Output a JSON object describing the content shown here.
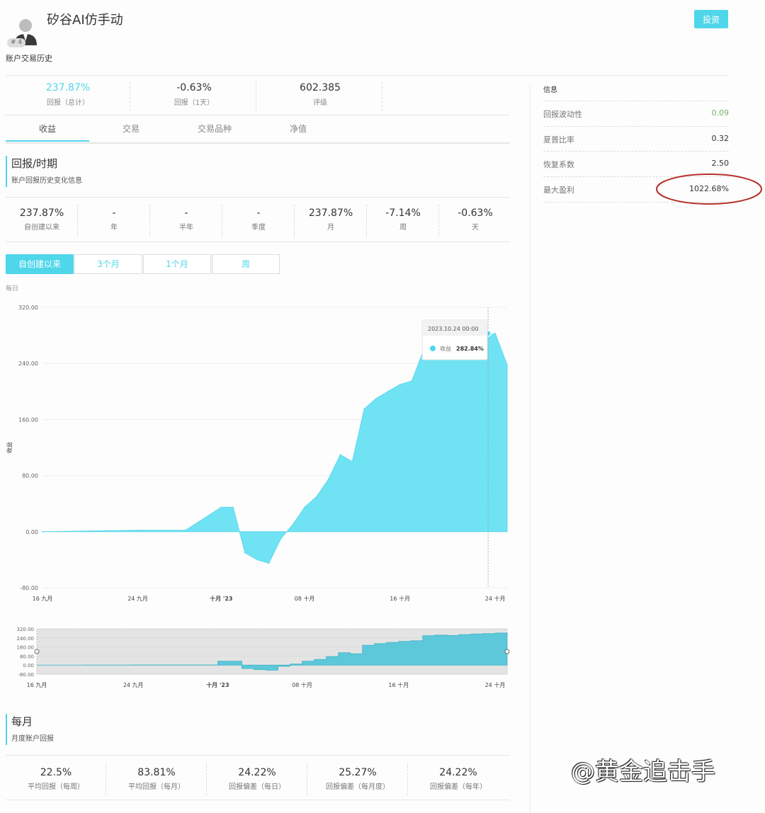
{
  "header": {
    "title": "矽谷AI仿手动",
    "badge": "# 4",
    "subtitle": "账户交易历史",
    "invest_label": "投资"
  },
  "stats": [
    {
      "value": "237.87%",
      "label": "回报（总计）",
      "color": "#4fd6ea"
    },
    {
      "value": "-0.63%",
      "label": "回报（1天）",
      "color": "#333333"
    },
    {
      "value": "602.385",
      "label": "评级",
      "color": "#333333"
    }
  ],
  "tabs": [
    "收益",
    "交易",
    "交易品种",
    "净值"
  ],
  "section_return": {
    "title": "回报/时期",
    "subtitle": "账户回报历史变化信息"
  },
  "periods": [
    {
      "value": "237.87%",
      "label": "自创建以来"
    },
    {
      "value": "-",
      "label": "年"
    },
    {
      "value": "-",
      "label": "半年"
    },
    {
      "value": "-",
      "label": "季度"
    },
    {
      "value": "237.87%",
      "label": "月"
    },
    {
      "value": "-7.14%",
      "label": "周"
    },
    {
      "value": "-0.63%",
      "label": "天"
    }
  ],
  "range_buttons": [
    "自创建以来",
    "3个月",
    "1个月",
    "周"
  ],
  "chart_caption": "每日",
  "info": {
    "heading": "信息",
    "rows": [
      {
        "key": "回报波动性",
        "value": "0.09"
      },
      {
        "key": "夏普比率",
        "value": "0.32"
      },
      {
        "key": "恢复系数",
        "value": "2.50"
      },
      {
        "key": "最大盈利",
        "value": "1022.68%"
      }
    ]
  },
  "section_monthly": {
    "title": "每月",
    "subtitle": "月度账户回报"
  },
  "monthly_stats": [
    {
      "value": "22.5%",
      "label": "平均回报（每周）"
    },
    {
      "value": "83.81%",
      "label": "平均回报（每月）"
    },
    {
      "value": "24.22%",
      "label": "回报偏差（每日）"
    },
    {
      "value": "25.27%",
      "label": "回报偏差（每月度）"
    },
    {
      "value": "24.22%",
      "label": "回报偏差（每年）"
    }
  ],
  "watermark": "@黄金追击手",
  "colors": {
    "accent": "#4fd6ea",
    "area": "#6fe3f4",
    "highlight_ring": "#b5312a"
  },
  "chart_data": {
    "type": "area",
    "ylabel": "收益",
    "ylim": [
      -80,
      320
    ],
    "yticks": [
      "320.00",
      "240.00",
      "160.00",
      "80.00",
      "0.00",
      "-80.00"
    ],
    "xticks": [
      "16 九月",
      "24 九月",
      "十月 '23",
      "08 十月",
      "16 十月",
      "24 十月"
    ],
    "x_dates": [
      "09-16",
      "09-20",
      "09-24",
      "09-28",
      "10-01",
      "10-02",
      "10-03",
      "10-04",
      "10-05",
      "10-06",
      "10-07",
      "10-08",
      "10-09",
      "10-10",
      "10-11",
      "10-12",
      "10-13",
      "10-14",
      "10-15",
      "10-16",
      "10-17",
      "10-18",
      "10-19",
      "10-20",
      "10-21",
      "10-22",
      "10-23",
      "10-24",
      "10-25"
    ],
    "x_days": [
      0,
      4,
      8,
      12,
      15,
      16,
      17,
      18,
      19,
      20,
      21,
      22,
      23,
      24,
      25,
      26,
      27,
      28,
      29,
      30,
      31,
      32,
      33,
      34,
      35,
      36,
      37,
      38,
      39
    ],
    "series": [
      {
        "name": "收益",
        "values": [
          0,
          1,
          2,
          2,
          35,
          35,
          -30,
          -40,
          -45,
          -10,
          10,
          35,
          50,
          75,
          110,
          100,
          175,
          190,
          200,
          210,
          215,
          260,
          265,
          262,
          270,
          275,
          278,
          282.84,
          237.87
        ]
      }
    ],
    "tooltip": {
      "date": "2023.10.24 00:00",
      "series": "收益",
      "value": "282.84%"
    },
    "navigator": {
      "yticks": [
        "320.00",
        "240.00",
        "160.00",
        "80.00",
        "0.00",
        "-80.00"
      ],
      "xticks": [
        "16 九月",
        "24 九月",
        "十月 '23",
        "08 十月",
        "16 十月",
        "24 十月"
      ]
    }
  }
}
